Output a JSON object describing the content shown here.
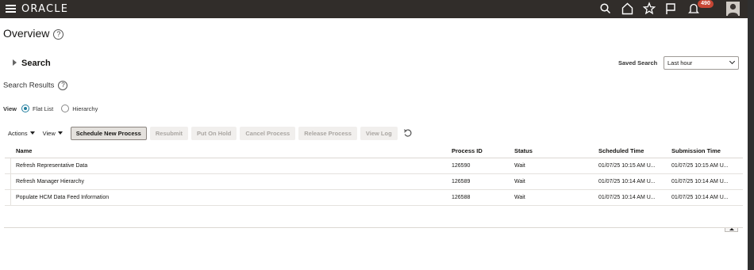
{
  "header": {
    "brand": "ORACLE",
    "notification_count": "490",
    "icons": [
      "menu-icon",
      "search-icon",
      "home-icon",
      "star-icon",
      "flag-icon",
      "bell-icon",
      "user-avatar"
    ]
  },
  "page": {
    "title": "Overview",
    "help": "?"
  },
  "search": {
    "toggle_label": "Search",
    "saved_search_label": "Saved Search",
    "saved_search_value": "Last hour"
  },
  "results": {
    "title": "Search Results",
    "view_label": "View",
    "view_options": [
      "Flat List",
      "Hierarchy"
    ],
    "view_selected": "Flat List"
  },
  "toolbar": {
    "actions_label": "Actions",
    "view_label": "View",
    "schedule_new_process": "Schedule New Process",
    "resubmit": "Resubmit",
    "put_on_hold": "Put On Hold",
    "cancel_process": "Cancel Process",
    "release_process": "Release Process",
    "view_log": "View Log"
  },
  "table": {
    "columns": [
      "Name",
      "Process ID",
      "Status",
      "Scheduled Time",
      "Submission Time"
    ],
    "rows": [
      {
        "name": "Refresh Representative Data",
        "process_id": "126590",
        "status": "Wait",
        "scheduled": "01/07/25 10:15 AM U...",
        "submitted": "01/07/25 10:15 AM U..."
      },
      {
        "name": "Refresh Manager Hierarchy",
        "process_id": "126589",
        "status": "Wait",
        "scheduled": "01/07/25 10:14 AM U...",
        "submitted": "01/07/25 10:14 AM U..."
      },
      {
        "name": "Populate HCM Data Feed Information",
        "process_id": "126588",
        "status": "Wait",
        "scheduled": "01/07/25 10:14 AM U...",
        "submitted": "01/07/25 10:14 AM U..."
      }
    ]
  },
  "colors": {
    "topbar": "#312d2a",
    "badge": "#c74634",
    "radio_accent": "#227e9e"
  }
}
